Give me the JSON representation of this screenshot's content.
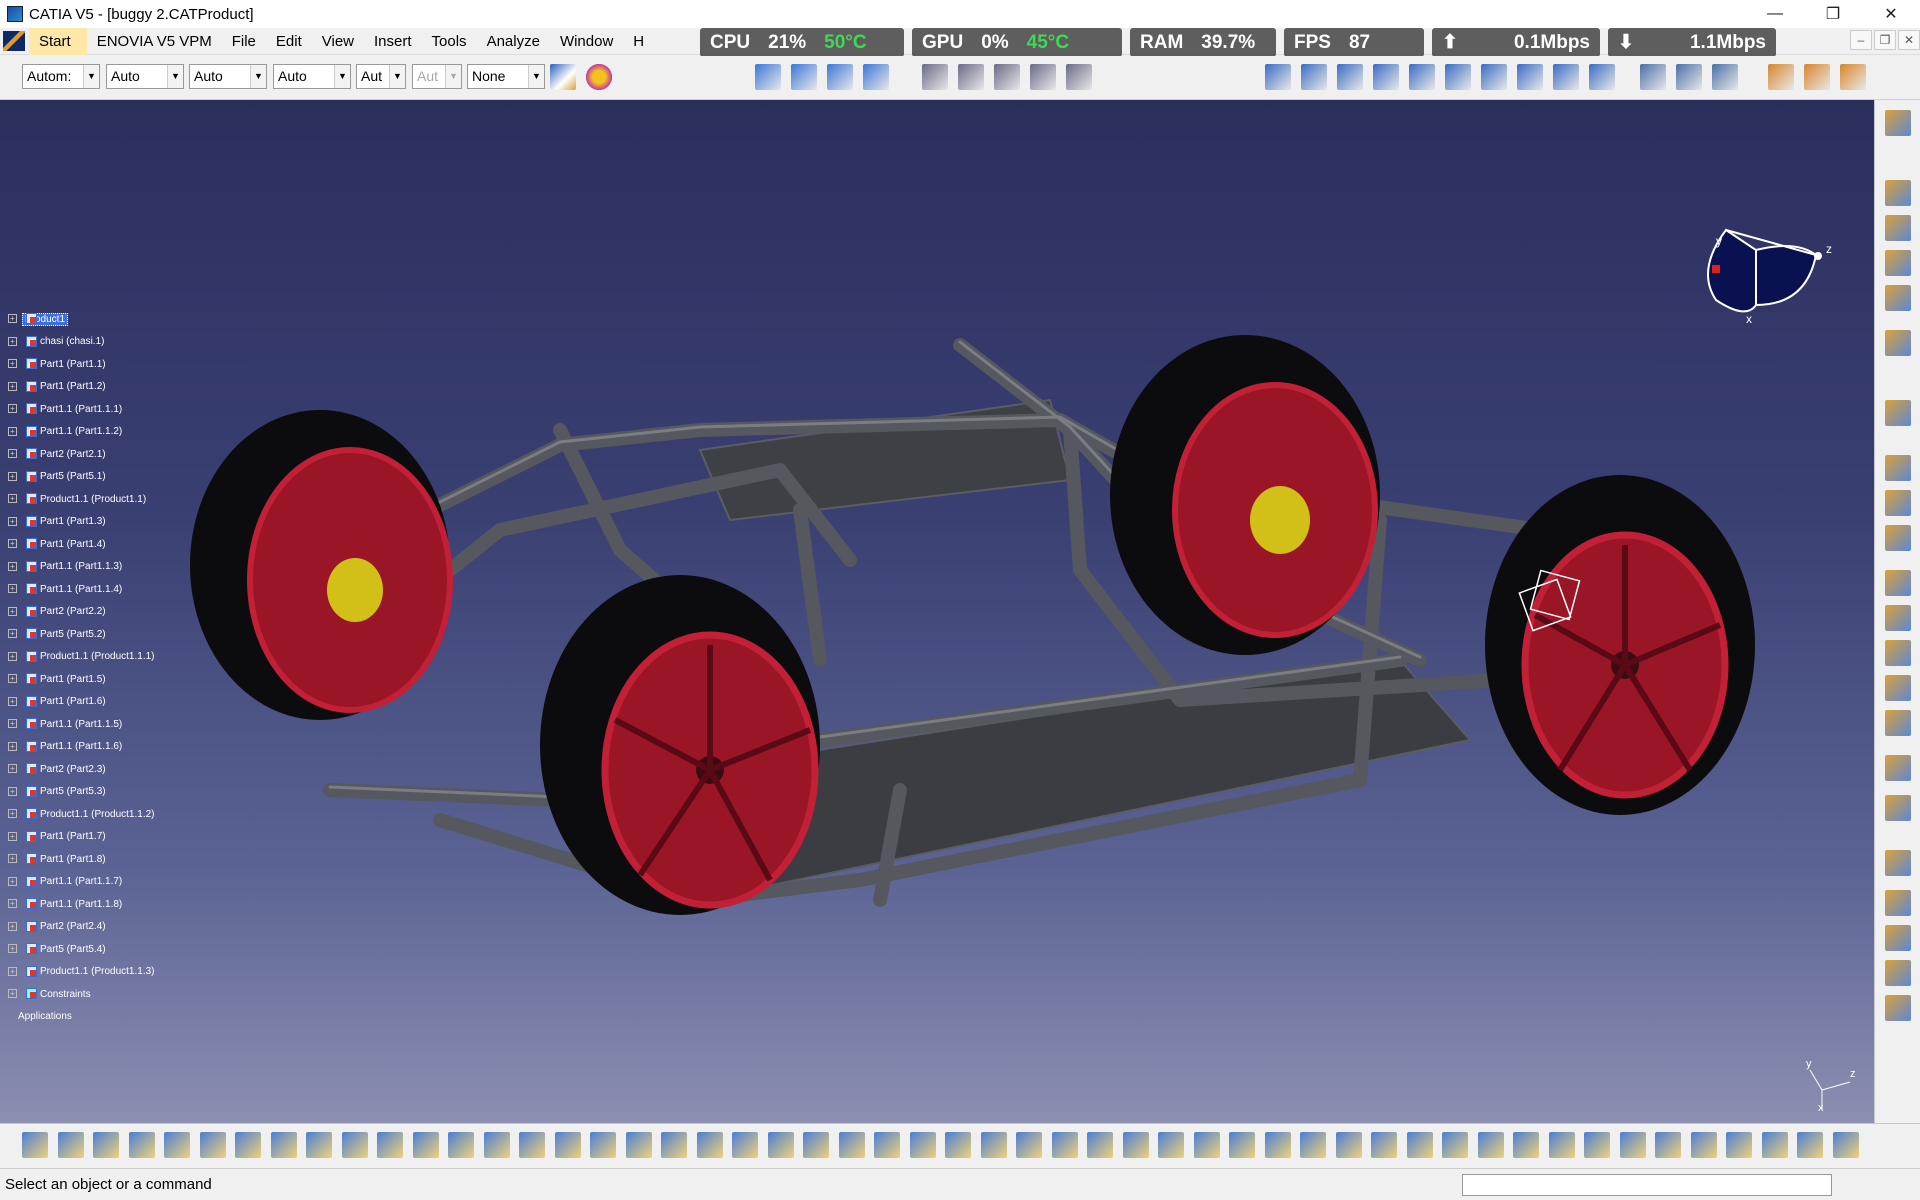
{
  "window": {
    "title": "CATIA V5 - [buggy 2.CATProduct]",
    "min": "—",
    "max": "❐",
    "close": "✕"
  },
  "menubar": {
    "items": [
      "Start",
      "ENOVIA V5 VPM",
      "File",
      "Edit",
      "View",
      "Insert",
      "Tools",
      "Analyze",
      "Window",
      "H"
    ]
  },
  "overlay": {
    "cpu": {
      "label": "CPU",
      "value": "21%",
      "temp": "50°C"
    },
    "gpu": {
      "label": "GPU",
      "value": "0%",
      "temp": "45°C"
    },
    "ram": {
      "label": "RAM",
      "value": "39.7%"
    },
    "fps": {
      "label": "FPS",
      "value": "87"
    },
    "up": {
      "icon": "⬆",
      "value": "0.1Mbps"
    },
    "down": {
      "icon": "⬇",
      "value": "1.1Mbps"
    }
  },
  "graphic_props": {
    "selects": [
      "Autom:",
      "Auto",
      "Auto",
      "Auto",
      "Aut",
      "Aut",
      "None"
    ]
  },
  "tree": {
    "root": "Product1",
    "nodes": [
      "chasi (chasi.1)",
      "Part1 (Part1.1)",
      "Part1 (Part1.2)",
      "Part1.1 (Part1.1.1)",
      "Part1.1 (Part1.1.2)",
      "Part2 (Part2.1)",
      "Part5 (Part5.1)",
      "Product1.1 (Product1.1)",
      "Part1 (Part1.3)",
      "Part1 (Part1.4)",
      "Part1.1 (Part1.1.3)",
      "Part1.1 (Part1.1.4)",
      "Part2 (Part2.2)",
      "Part5 (Part5.2)",
      "Product1.1 (Product1.1.1)",
      "Part1 (Part1.5)",
      "Part1 (Part1.6)",
      "Part1.1 (Part1.1.5)",
      "Part1.1 (Part1.1.6)",
      "Part2 (Part2.3)",
      "Part5 (Part5.3)",
      "Product1.1 (Product1.1.2)",
      "Part1 (Part1.7)",
      "Part1 (Part1.8)",
      "Part1.1 (Part1.1.7)",
      "Part1.1 (Part1.1.8)",
      "Part2 (Part2.4)",
      "Part5 (Part5.4)",
      "Product1.1 (Product1.1.3)"
    ],
    "constraints": "Constraints",
    "applications": "Applications"
  },
  "compass": {
    "x": "x",
    "y": "y",
    "z": "z"
  },
  "status": {
    "message": "Select an object or a command"
  },
  "colors": {
    "viewport_top": "#2b2f5e",
    "viewport_bottom": "#8b8fb1",
    "rim": "#b0182a",
    "frame": "#4a4d52",
    "caliper": "#e3c21a"
  }
}
